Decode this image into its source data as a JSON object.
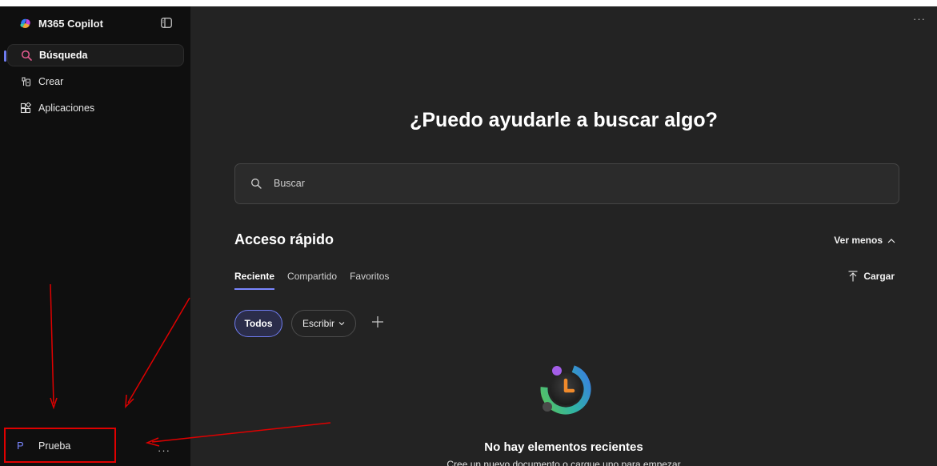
{
  "app": {
    "title": "M365 Copilot"
  },
  "sidebar": {
    "items": [
      {
        "label": "Búsqueda",
        "icon": "search-icon",
        "active": true
      },
      {
        "label": "Crear",
        "icon": "create-icon",
        "active": false
      },
      {
        "label": "Aplicaciones",
        "icon": "apps-icon",
        "active": false
      }
    ],
    "user": {
      "initial": "P",
      "name": "Prueba",
      "more": "···"
    }
  },
  "main": {
    "top_more": "···",
    "heading": "¿Puedo ayudarle a buscar algo?",
    "search": {
      "placeholder": "Buscar"
    },
    "quick_access": {
      "title": "Acceso rápido",
      "toggle_label": "Ver menos",
      "tabs": [
        "Reciente",
        "Compartido",
        "Favoritos"
      ],
      "active_tab": "Reciente",
      "upload_label": "Cargar",
      "filters": {
        "all": "Todos",
        "write": "Escribir"
      }
    },
    "empty": {
      "title": "No hay elementos recientes",
      "subtitle": "Cree un nuevo documento o cargue uno para empezar"
    }
  },
  "colors": {
    "accent": "#6f7cf0",
    "annotation": "#e00000",
    "sidebar_bg": "#0f0f0f",
    "main_bg": "#232323"
  }
}
